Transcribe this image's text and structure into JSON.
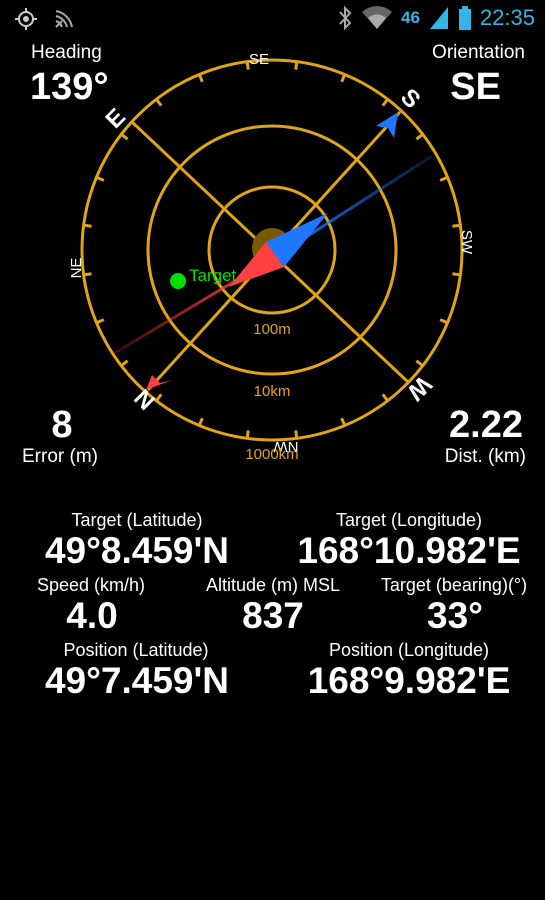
{
  "status_bar": {
    "network_type": "46",
    "time": "22:35",
    "icons": [
      "gps-icon",
      "broadcast-icon",
      "bluetooth-icon",
      "wifi-icon",
      "signal-icon",
      "battery-icon"
    ]
  },
  "heading": {
    "label": "Heading",
    "value": "139°"
  },
  "orientation": {
    "label": "Orientation",
    "value": "SE"
  },
  "error": {
    "value": "8",
    "label": "Error (m)"
  },
  "distance": {
    "value": "2.22",
    "label": "Dist. (km)"
  },
  "compass": {
    "ring_color": "#e0a418",
    "target_color": "#00e000",
    "north_color": "#ff4040",
    "south_color": "#1e78ff",
    "cardinals": {
      "N": "N",
      "E": "E",
      "S": "S",
      "W": "W"
    },
    "intercardinals": {
      "NE": "NE",
      "SE": "SE",
      "SW": "SW",
      "NW": "NW"
    },
    "ring_labels": [
      "100m",
      "10km",
      "1000km"
    ],
    "target_label": "Target"
  },
  "target_lat": {
    "label": "Target (Latitude)",
    "value": "49°8.459'N"
  },
  "target_lon": {
    "label": "Target (Longitude)",
    "value": "168°10.982'E"
  },
  "speed": {
    "label": "Speed (km/h)",
    "value": "4.0"
  },
  "altitude": {
    "label": "Altitude (m) MSL",
    "value": "837"
  },
  "bearing": {
    "label": "Target (bearing)(°)",
    "value": "33°"
  },
  "position_lat": {
    "label": "Position (Latitude)",
    "value": "49°7.459'N"
  },
  "position_lon": {
    "label": "Position (Longitude)",
    "value": "168°9.982'E"
  }
}
